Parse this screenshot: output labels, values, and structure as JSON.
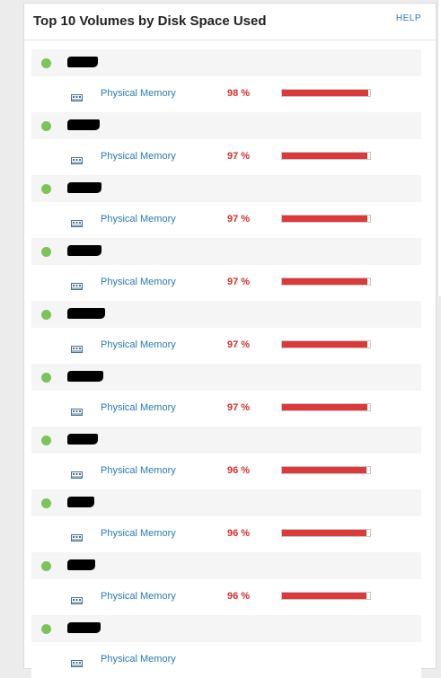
{
  "widget": {
    "title": "Top 10 Volumes by Disk Space Used",
    "help": "HELP"
  },
  "colors": {
    "status_up": "#7cc35a",
    "bar_fill": "#dc3a3a",
    "link": "#2a7ab0",
    "critical_text": "#d32f2f"
  },
  "rows": [
    {
      "node": "[redacted]",
      "status": "up",
      "icon": "memory-chip-icon",
      "metric": "Physical Memory",
      "percent": "98 %",
      "percent_value": 98
    },
    {
      "node": "[redacted]",
      "status": "up",
      "icon": "memory-chip-icon",
      "metric": "Physical Memory",
      "percent": "97 %",
      "percent_value": 97
    },
    {
      "node": "[redacted]",
      "status": "up",
      "icon": "memory-chip-icon",
      "metric": "Physical Memory",
      "percent": "97 %",
      "percent_value": 97
    },
    {
      "node": "[redacted]",
      "status": "up",
      "icon": "memory-chip-icon",
      "metric": "Physical Memory",
      "percent": "97 %",
      "percent_value": 97
    },
    {
      "node": "[redacted]",
      "status": "up",
      "icon": "memory-chip-icon",
      "metric": "Physical Memory",
      "percent": "97 %",
      "percent_value": 97
    },
    {
      "node": "[redacted]",
      "status": "up",
      "icon": "memory-chip-icon",
      "metric": "Physical Memory",
      "percent": "97 %",
      "percent_value": 97
    },
    {
      "node": "[redacted]",
      "status": "up",
      "icon": "memory-chip-icon",
      "metric": "Physical Memory",
      "percent": "96 %",
      "percent_value": 96
    },
    {
      "node": "[redacted]",
      "status": "up",
      "icon": "memory-chip-icon",
      "metric": "Physical Memory",
      "percent": "96 %",
      "percent_value": 96
    },
    {
      "node": "[redacted]",
      "status": "up",
      "icon": "memory-chip-icon",
      "metric": "Physical Memory",
      "percent": "96 %",
      "percent_value": 96
    },
    {
      "node": "[redacted]",
      "status": "up",
      "icon": "memory-chip-icon",
      "metric": "Physical Memory",
      "percent": "",
      "percent_value": null
    }
  ]
}
